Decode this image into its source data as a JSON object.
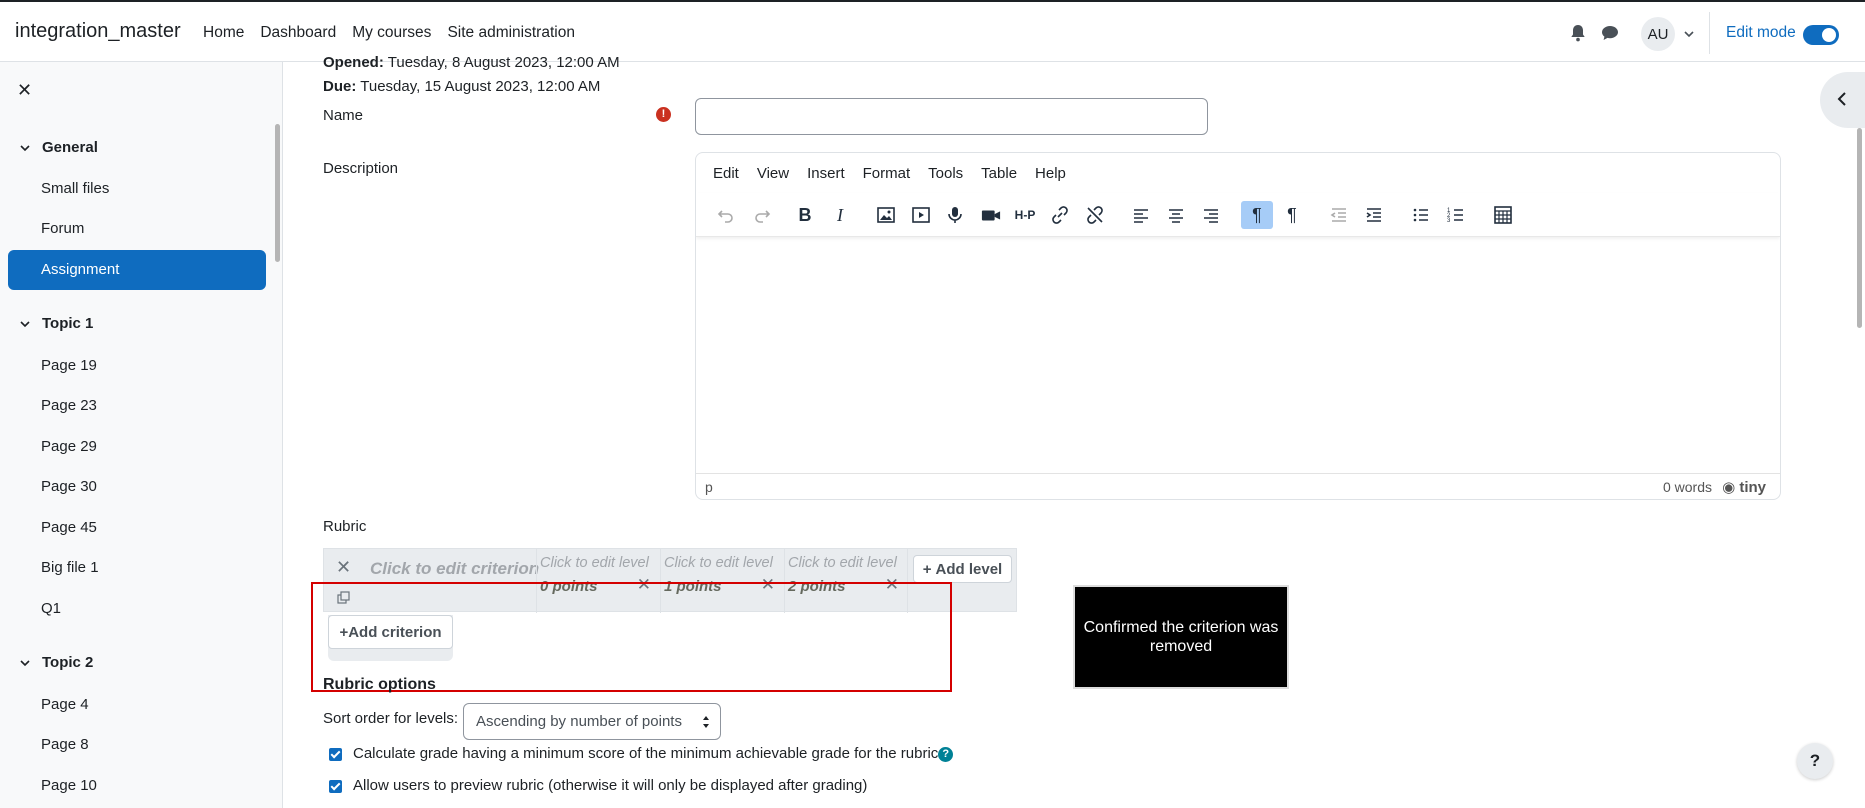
{
  "header": {
    "brand": "integration_master",
    "nav": [
      "Home",
      "Dashboard",
      "My courses",
      "Site administration"
    ],
    "avatar_initials": "AU",
    "edit_mode_label": "Edit mode",
    "edit_mode_on": true
  },
  "sidebar": {
    "sections": [
      {
        "title": "General",
        "items": [
          "Small files",
          "Forum",
          "Assignment"
        ]
      },
      {
        "title": "Topic 1",
        "items": [
          "Page 19",
          "Page 23",
          "Page 29",
          "Page 30",
          "Page 45",
          "Big file 1",
          "Q1"
        ]
      },
      {
        "title": "Topic 2",
        "items": [
          "Page 4",
          "Page 8",
          "Page 10"
        ]
      }
    ],
    "active_item": "Assignment"
  },
  "main": {
    "opened_label": "Opened:",
    "opened_value": "Tuesday, 8 August 2023, 12:00 AM",
    "due_label": "Due:",
    "due_value": "Tuesday, 15 August 2023, 12:00 AM",
    "name_label": "Name",
    "name_value": "",
    "description_label": "Description",
    "editor": {
      "menus": [
        "Edit",
        "View",
        "Insert",
        "Format",
        "Tools",
        "Table",
        "Help"
      ],
      "status_path": "p",
      "word_count": "0 words",
      "brand": "tiny"
    },
    "rubric": {
      "label": "Rubric",
      "criterion_placeholder": "Click to edit criterion",
      "levels": [
        {
          "text": "Click to edit level",
          "points": "0 points"
        },
        {
          "text": "Click to edit level",
          "points": "1 points"
        },
        {
          "text": "Click to edit level",
          "points": "2 points"
        }
      ],
      "add_level": "Add level",
      "add_criterion": "Add criterion",
      "tooltip": "Confirmed the criterion was removed"
    },
    "rubric_options": {
      "title": "Rubric options",
      "sort_label": "Sort order for levels:",
      "sort_value": "Ascending by number of points",
      "options": [
        {
          "label": "Calculate grade having a minimum score of the minimum achievable grade for the rubric",
          "checked": true
        },
        {
          "label": "Allow users to preview rubric (otherwise it will only be displayed after grading)",
          "checked": true
        }
      ]
    },
    "help_button": "?"
  }
}
